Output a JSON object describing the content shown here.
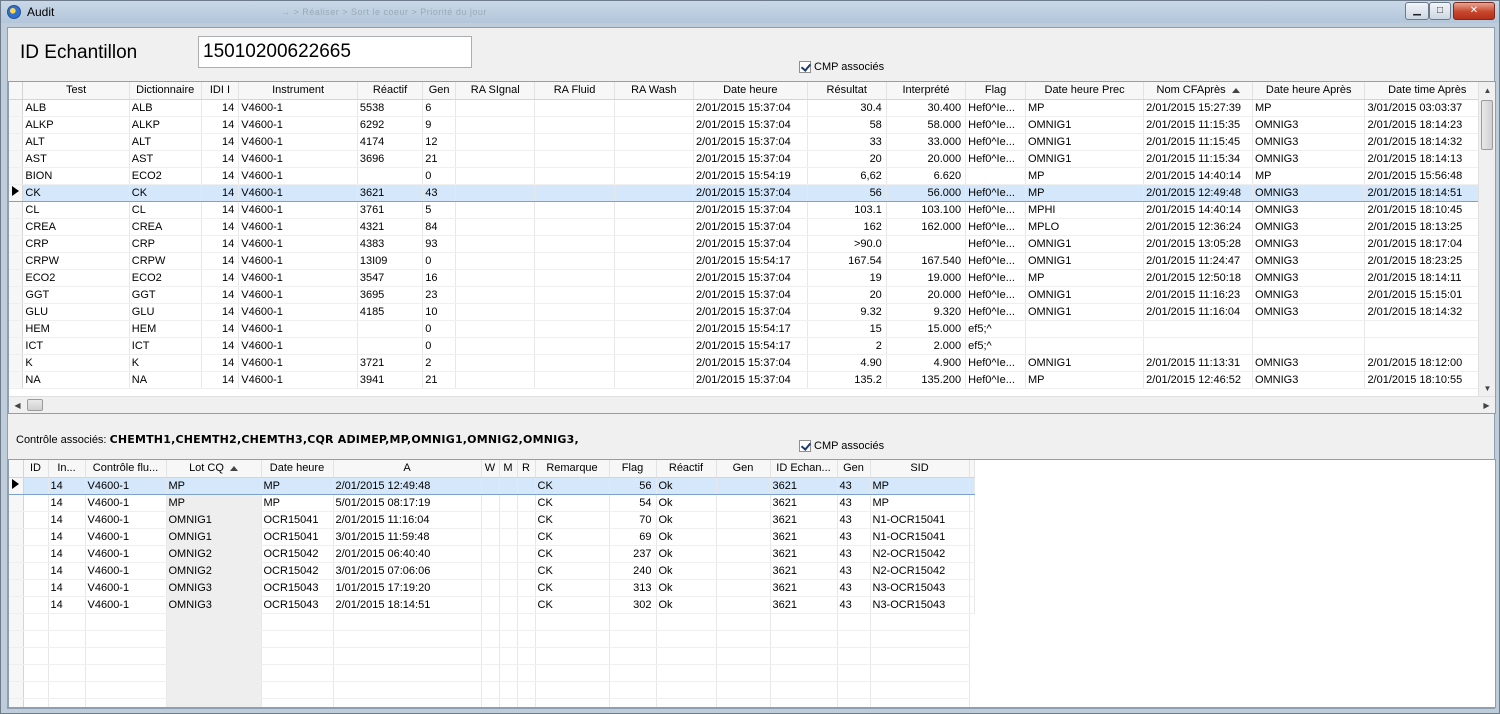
{
  "window": {
    "title": "Audit",
    "ghost_title": "→ > Réaliser > Sort le coeur > Priorité du jour",
    "minimize_glyph": "▁",
    "maximize_glyph": "□",
    "close_glyph": "✕"
  },
  "header": {
    "id_label": "ID Echantillon",
    "id_value": "15010200622665",
    "cmp_label": "CMP associés"
  },
  "tests_grid": {
    "columns": [
      "Test",
      "Dictionnaire",
      "IDI I",
      "Instrument",
      "Réactif",
      "Gen",
      "RA SIgnal",
      "RA Fluid",
      "RA Wash",
      "Date heure",
      "Résultat",
      "Interprété",
      "Flag",
      "Date heure Prec",
      "Nom CFAprès",
      "Date heure Après",
      "Date time Après"
    ],
    "sorted_column": "Nom CFAprès",
    "selected_row": 5,
    "rows": [
      [
        "ALB",
        "ALB",
        "14",
        "V4600-1",
        "5538",
        "6",
        "",
        "",
        "",
        "2/01/2015 15:37:04",
        "30.4",
        "30.400",
        "Hef0^Ie...",
        "MP",
        "2/01/2015 15:27:39",
        "MP",
        "3/01/2015 03:03:37"
      ],
      [
        "ALKP",
        "ALKP",
        "14",
        "V4600-1",
        "6292",
        "9",
        "",
        "",
        "",
        "2/01/2015 15:37:04",
        "58",
        "58.000",
        "Hef0^Ie...",
        "OMNIG1",
        "2/01/2015 11:15:35",
        "OMNIG3",
        "2/01/2015 18:14:23"
      ],
      [
        "ALT",
        "ALT",
        "14",
        "V4600-1",
        "4174",
        "12",
        "",
        "",
        "",
        "2/01/2015 15:37:04",
        "33",
        "33.000",
        "Hef0^Ie...",
        "OMNIG1",
        "2/01/2015 11:15:45",
        "OMNIG3",
        "2/01/2015 18:14:32"
      ],
      [
        "AST",
        "AST",
        "14",
        "V4600-1",
        "3696",
        "21",
        "",
        "",
        "",
        "2/01/2015 15:37:04",
        "20",
        "20.000",
        "Hef0^Ie...",
        "OMNIG1",
        "2/01/2015 11:15:34",
        "OMNIG3",
        "2/01/2015 18:14:13"
      ],
      [
        "BION",
        "ECO2",
        "14",
        "V4600-1",
        "",
        "0",
        "",
        "",
        "",
        "2/01/2015 15:54:19",
        "6,62",
        "6.620",
        "",
        "MP",
        "2/01/2015 14:40:14",
        "MP",
        "2/01/2015 15:56:48"
      ],
      [
        "CK",
        "CK",
        "14",
        "V4600-1",
        "3621",
        "43",
        "",
        "",
        "",
        "2/01/2015 15:37:04",
        "56",
        "56.000",
        "Hef0^Ie...",
        "MP",
        "2/01/2015 12:49:48",
        "OMNIG3",
        "2/01/2015 18:14:51"
      ],
      [
        "CL",
        "CL",
        "14",
        "V4600-1",
        "3761",
        "5",
        "",
        "",
        "",
        "2/01/2015 15:37:04",
        "103.1",
        "103.100",
        "Hef0^Ie...",
        "MPHI",
        "2/01/2015 14:40:14",
        "OMNIG3",
        "2/01/2015 18:10:45"
      ],
      [
        "CREA",
        "CREA",
        "14",
        "V4600-1",
        "4321",
        "84",
        "",
        "",
        "",
        "2/01/2015 15:37:04",
        "162",
        "162.000",
        "Hef0^Ie...",
        "MPLO",
        "2/01/2015 12:36:24",
        "OMNIG3",
        "2/01/2015 18:13:25"
      ],
      [
        "CRP",
        "CRP",
        "14",
        "V4600-1",
        "4383",
        "93",
        "",
        "",
        "",
        "2/01/2015 15:37:04",
        ">90.0",
        "",
        "Hef0^Ie...",
        "OMNIG1",
        "2/01/2015 13:05:28",
        "OMNIG3",
        "2/01/2015 18:17:04"
      ],
      [
        "CRPW",
        "CRPW",
        "14",
        "V4600-1",
        "13I09",
        "0",
        "",
        "",
        "",
        "2/01/2015 15:54:17",
        "167.54",
        "167.540",
        "Hef0^Ie...",
        "OMNIG1",
        "2/01/2015 11:24:47",
        "OMNIG3",
        "2/01/2015 18:23:25"
      ],
      [
        "ECO2",
        "ECO2",
        "14",
        "V4600-1",
        "3547",
        "16",
        "",
        "",
        "",
        "2/01/2015 15:37:04",
        "19",
        "19.000",
        "Hef0^Ie...",
        "MP",
        "2/01/2015 12:50:18",
        "OMNIG3",
        "2/01/2015 18:14:11"
      ],
      [
        "GGT",
        "GGT",
        "14",
        "V4600-1",
        "3695",
        "23",
        "",
        "",
        "",
        "2/01/2015 15:37:04",
        "20",
        "20.000",
        "Hef0^Ie...",
        "OMNIG1",
        "2/01/2015 11:16:23",
        "OMNIG3",
        "2/01/2015 15:15:01"
      ],
      [
        "GLU",
        "GLU",
        "14",
        "V4600-1",
        "4185",
        "10",
        "",
        "",
        "",
        "2/01/2015 15:37:04",
        "9.32",
        "9.320",
        "Hef0^Ie...",
        "OMNIG1",
        "2/01/2015 11:16:04",
        "OMNIG3",
        "2/01/2015 18:14:32"
      ],
      [
        "HEM",
        "HEM",
        "14",
        "V4600-1",
        "",
        "0",
        "",
        "",
        "",
        "2/01/2015 15:54:17",
        "15",
        "15.000",
        "ef5;^",
        "",
        "",
        "",
        ""
      ],
      [
        "ICT",
        "ICT",
        "14",
        "V4600-1",
        "",
        "0",
        "",
        "",
        "",
        "2/01/2015 15:54:17",
        "2",
        "2.000",
        "ef5;^",
        "",
        "",
        "",
        ""
      ],
      [
        "K",
        "K",
        "14",
        "V4600-1",
        "3721",
        "2",
        "",
        "",
        "",
        "2/01/2015 15:37:04",
        "4.90",
        "4.900",
        "Hef0^Ie...",
        "OMNIG1",
        "2/01/2015 11:13:31",
        "OMNIG3",
        "2/01/2015 18:12:00"
      ],
      [
        "NA",
        "NA",
        "14",
        "V4600-1",
        "3941",
        "21",
        "",
        "",
        "",
        "2/01/2015 15:37:04",
        "135.2",
        "135.200",
        "Hef0^Ie...",
        "MP",
        "2/01/2015 12:46:52",
        "OMNIG3",
        "2/01/2015 18:10:55"
      ]
    ]
  },
  "controls": {
    "label": "Contrôle associés:",
    "value": "CHEMTH1,CHEMTH2,CHEMTH3,CQR ADIMEP,MP,OMNIG1,OMNIG2,OMNIG3,",
    "cmp_label": "CMP associés"
  },
  "controls_grid": {
    "columns": [
      "ID",
      "In...",
      "Contrôle flu...",
      "Lot CQ",
      "Date heure",
      "A",
      "W",
      "M",
      "R",
      "Remarque",
      "Flag",
      "Réactif",
      "Gen",
      "ID Echan...",
      "Gen",
      "SID"
    ],
    "sorted_column": "Lot CQ",
    "selected_row": 0,
    "rows": [
      [
        "",
        "14",
        "V4600-1",
        "MP",
        "MP",
        "2/01/2015 12:49:48",
        "",
        "",
        "",
        "CK",
        "56",
        "Ok",
        "",
        "3621",
        "43",
        "MP"
      ],
      [
        "",
        "14",
        "V4600-1",
        "MP",
        "MP",
        "5/01/2015 08:17:19",
        "",
        "",
        "",
        "CK",
        "54",
        "Ok",
        "",
        "3621",
        "43",
        "MP"
      ],
      [
        "",
        "14",
        "V4600-1",
        "OMNIG1",
        "OCR15041",
        "2/01/2015 11:16:04",
        "",
        "",
        "",
        "CK",
        "70",
        "Ok",
        "",
        "3621",
        "43",
        "N1-OCR15041"
      ],
      [
        "",
        "14",
        "V4600-1",
        "OMNIG1",
        "OCR15041",
        "3/01/2015 11:59:48",
        "",
        "",
        "",
        "CK",
        "69",
        "Ok",
        "",
        "3621",
        "43",
        "N1-OCR15041"
      ],
      [
        "",
        "14",
        "V4600-1",
        "OMNIG2",
        "OCR15042",
        "2/01/2015 06:40:40",
        "",
        "",
        "",
        "CK",
        "237",
        "Ok",
        "",
        "3621",
        "43",
        "N2-OCR15042"
      ],
      [
        "",
        "14",
        "V4600-1",
        "OMNIG2",
        "OCR15042",
        "3/01/2015 07:06:06",
        "",
        "",
        "",
        "CK",
        "240",
        "Ok",
        "",
        "3621",
        "43",
        "N2-OCR15042"
      ],
      [
        "",
        "14",
        "V4600-1",
        "OMNIG3",
        "OCR15043",
        "1/01/2015 17:19:20",
        "",
        "",
        "",
        "CK",
        "313",
        "Ok",
        "",
        "3621",
        "43",
        "N3-OCR15043"
      ],
      [
        "",
        "14",
        "V4600-1",
        "OMNIG3",
        "OCR15043",
        "2/01/2015 18:14:51",
        "",
        "",
        "",
        "CK",
        "302",
        "Ok",
        "",
        "3621",
        "43",
        "N3-OCR15043"
      ]
    ],
    "empty_rows": 6
  },
  "colors": {
    "selection": "#d5e8fb",
    "selection_border": "#7da2ce",
    "frame": "#bfcddb"
  }
}
